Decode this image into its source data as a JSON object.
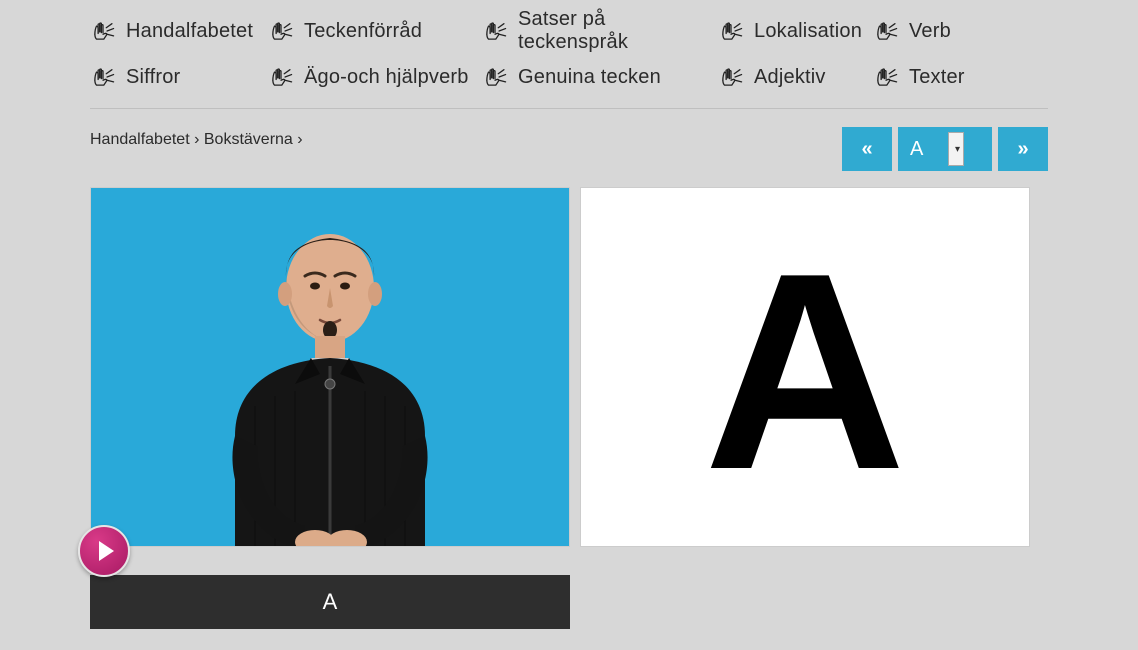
{
  "nav": {
    "row1": [
      {
        "label": "Handalfabetet"
      },
      {
        "label": "Teckenförråd"
      },
      {
        "label": "Satser på teckenspråk"
      },
      {
        "label": "Lokalisation"
      },
      {
        "label": "Verb"
      }
    ],
    "row2": [
      {
        "label": "Siffror"
      },
      {
        "label": "Ägo-och hjälpverb"
      },
      {
        "label": "Genuina tecken"
      },
      {
        "label": "Adjektiv"
      },
      {
        "label": "Texter"
      }
    ]
  },
  "breadcrumb": {
    "part1": "Handalfabetet",
    "sep": "›",
    "part2": "Bokstäverna",
    "trailing_sep": "›"
  },
  "pager": {
    "prev_label": "«",
    "selected": "A",
    "next_label": "»"
  },
  "letter": "A",
  "caption": "A",
  "colors": {
    "accent": "#30aad1",
    "play": "#b81f6d"
  }
}
